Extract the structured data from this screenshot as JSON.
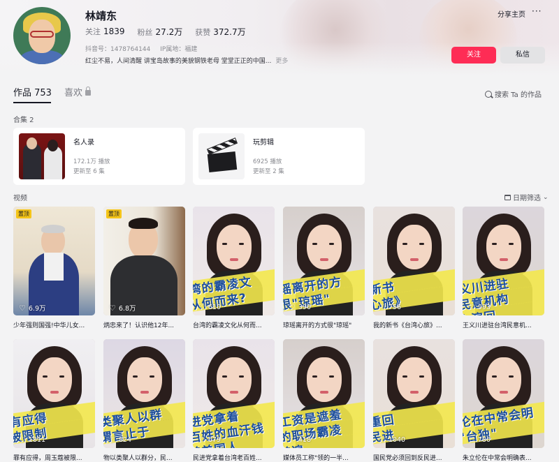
{
  "profile": {
    "name": "林靖东",
    "follow_label": "关注",
    "follow_count": "1839",
    "fans_label": "粉丝",
    "fans_count": "27.2万",
    "likes_label": "获赞",
    "likes_count": "372.7万",
    "douyin_id": "抖音号：1478764144",
    "ip_location": "IP属地：福建",
    "bio": "红尘不易，人间清醒 讲宝岛故事的美貌钢铁老母 堂堂正正的中国...",
    "bio_more": "更多"
  },
  "actions": {
    "share": "分享主页",
    "more": "···",
    "follow_button": "关注",
    "message_button": "私信"
  },
  "tabs": {
    "works": "作品 753",
    "likes": "喜欢",
    "search": "搜索 Ta 的作品"
  },
  "collections": {
    "label": "合集 2",
    "items": [
      {
        "title": "名人录",
        "plays": "172.1万 播放",
        "updated": "更新至 6 集"
      },
      {
        "title": "玩剪辑",
        "plays": "6925 播放",
        "updated": "更新至 2 集"
      }
    ]
  },
  "videos": {
    "label": "视频",
    "filter": "日期筛选",
    "pinned_label": "置顶",
    "items": [
      {
        "title": "少年强则国强!中华儿女...",
        "likes": "6.9万",
        "pinned": true,
        "caption": ""
      },
      {
        "title": "炳忠来了！认识他12年...",
        "likes": "6.8万",
        "pinned": true,
        "caption": ""
      },
      {
        "title": "台湾的霸凌文化从何而...",
        "likes": "610",
        "pinned": false,
        "caption": "湾的霸凌文 从何而来?"
      },
      {
        "title": "琼瑶离开的方式很\"琼瑶\"",
        "likes": "390",
        "pinned": false,
        "caption": "瑶离开的方 很\"琼瑶\""
      },
      {
        "title": "我的新书《台湾心旅》...",
        "likes": "756",
        "pinned": false,
        "caption": "新书 心旅》"
      },
      {
        "title": "王义川进驻台湾民意机...",
        "likes": "993",
        "pinned": false,
        "caption": "义川进驻 民意机构 上演回"
      },
      {
        "title": "罪有应得，周玉蔻被限...",
        "likes": "1811",
        "pinned": false,
        "caption": "有应得 被限制"
      },
      {
        "title": "物以类聚人以群分，民...",
        "likes": "824",
        "pinned": false,
        "caption": "类聚人以群 谓言止于"
      },
      {
        "title": "民进党拿着台湾老百姓...",
        "likes": "679",
        "pinned": false,
        "caption": "进党拿着 百姓的血汗钱 养美国人"
      },
      {
        "title": "媒体员工称\"领的一半...",
        "likes": "418",
        "pinned": false,
        "caption": "工资是遮羞 的职场霸凌 普遍"
      },
      {
        "title": "国民党必须回到反民进...",
        "likes": "1040",
        "pinned": false,
        "caption": "重回 民进"
      },
      {
        "title": "朱立伦在中常会明确表...",
        "likes": "780",
        "pinned": false,
        "caption": "伦在中常会明 \"台独\""
      }
    ]
  }
}
